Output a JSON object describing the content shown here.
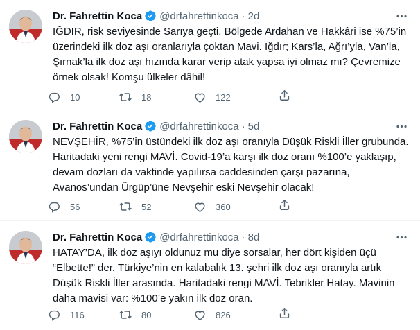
{
  "author": {
    "name": "Dr. Fahrettin Koca",
    "handle": "@drfahrettinkoca",
    "separator": "·"
  },
  "colors": {
    "verified": "#1d9bf0",
    "text": "#0f1419",
    "muted": "#536471",
    "divider": "#eff3f4"
  },
  "tweets": [
    {
      "time": "2d",
      "lines": [
        "IĞDIR, risk seviyesinde Sarıya geçti. Bölgede Ardahan ve Hakkâri ise %75’in",
        "üzerindeki ilk doz aşı oranlarıyla çoktan Mavi. Iğdır; Kars’la, Ağrı’yla, Van’la,",
        "Şırnak’la ilk doz aşı hızında karar verip atak yapsa iyi olmaz mı? Çevremize",
        "örnek olsak! Komşu ülkeler dâhil!"
      ],
      "replies": "10",
      "retweets": "18",
      "likes": "122"
    },
    {
      "time": "5d",
      "lines": [
        "NEVŞEHİR, %75’in üstündeki ilk doz aşı oranıyla Düşük Riskli İller grubunda.",
        "Haritadaki yeni rengi MAVİ. Covid-19’a karşı ilk doz oranı %100’e yaklaşıp,",
        "devam dozları da vaktinde yapılırsa caddesinden çarşı pazarına,",
        "Avanos’undan Ürgüp’üne Nevşehir eski Nevşehir olacak!"
      ],
      "replies": "56",
      "retweets": "52",
      "likes": "360"
    },
    {
      "time": "8d",
      "lines": [
        "HATAY’DA, ilk doz aşıyı oldunuz mu diye sorsalar, her dört kişiden üçü",
        "“Elbette!” der. Türkiye’nin en kalabalık 13. şehri ilk doz aşı oranıyla artık",
        "Düşük Riskli İller arasında. Haritadaki rengi MAVİ. Tebrikler Hatay. Mavinin",
        "daha mavisi var: %100’e yakın ilk doz oran."
      ],
      "replies": "116",
      "retweets": "80",
      "likes": "826"
    }
  ],
  "icons": {
    "avatar": "avatar",
    "verified": "verified-badge-icon",
    "more": "more-options-icon",
    "reply": "reply-icon",
    "retweet": "retweet-icon",
    "like": "like-icon",
    "share": "share-icon"
  }
}
